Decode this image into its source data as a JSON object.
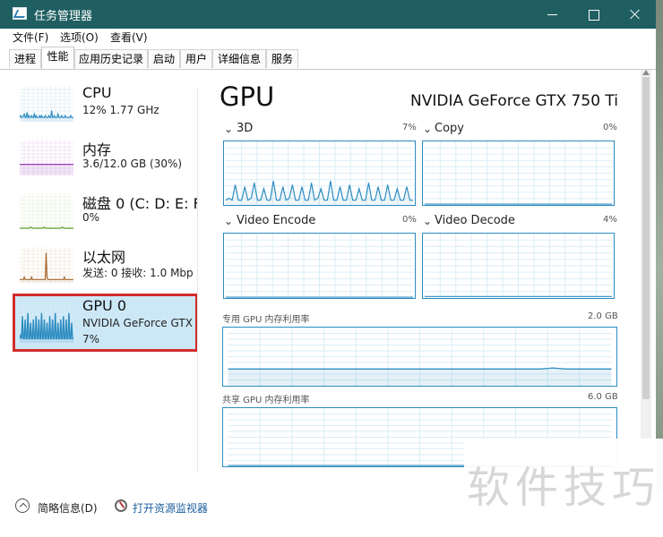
{
  "window": {
    "title": "任务管理器",
    "controls": {
      "minimize": "",
      "maximize": "",
      "close": ""
    }
  },
  "menu": [
    "文件(F)",
    "选项(O)",
    "查看(V)"
  ],
  "tabs": [
    "进程",
    "性能",
    "应用历史记录",
    "启动",
    "用户",
    "详细信息",
    "服务"
  ],
  "sidebar": {
    "items": [
      {
        "name": "CPU",
        "line1": "12% 1.77 GHz",
        "line2": "",
        "color": "#2c8bc0",
        "chart_data": {
          "type": "line",
          "values": [
            2,
            3,
            2,
            2,
            3,
            4,
            2,
            2,
            5,
            2,
            3,
            2,
            2,
            3,
            2,
            2,
            4,
            2,
            3,
            2,
            2,
            2,
            3,
            2,
            3,
            2,
            2,
            2,
            3,
            2,
            2,
            2,
            3,
            2,
            2,
            6,
            2,
            2,
            3,
            2,
            2,
            2,
            4,
            2,
            2,
            2,
            3,
            2,
            2,
            2,
            3,
            2,
            2,
            2,
            2,
            2,
            3,
            2,
            2,
            2
          ]
        }
      },
      {
        "name": "内存",
        "line1": "3.6/12.0 GB (30%)",
        "line2": "",
        "color": "#9b3db5",
        "chart_data": {
          "type": "area",
          "values": [
            30,
            30,
            30,
            30,
            30,
            30,
            30,
            30,
            30,
            30,
            30,
            30,
            30,
            30,
            30,
            30,
            30,
            30,
            30,
            30,
            30,
            30,
            30,
            30,
            30,
            30,
            30,
            30,
            30,
            30
          ]
        }
      },
      {
        "name": "磁盘 0 (C: D: E: F:",
        "line1": "0%",
        "line2": "",
        "color": "#5d9f2d",
        "chart_data": {
          "type": "line",
          "values": [
            0,
            0,
            0,
            0,
            0,
            0,
            1,
            0,
            0,
            0,
            0,
            0,
            0,
            1,
            0,
            0,
            0,
            0,
            0,
            0,
            0,
            0,
            0,
            1,
            0,
            0,
            0,
            0,
            0,
            0
          ]
        }
      },
      {
        "name": "以太网",
        "line1": "发送: 0 接收: 1.0 Mbp",
        "line2": "",
        "color": "#a5672e",
        "chart_data": {
          "type": "line",
          "values": [
            1,
            1,
            1,
            1,
            1,
            2,
            1,
            1,
            1,
            1,
            1,
            1,
            1,
            2,
            1,
            1,
            1,
            1,
            1,
            1,
            1,
            1,
            1,
            1,
            1,
            1,
            1,
            1,
            1,
            12,
            2,
            1,
            1,
            1,
            1,
            1,
            1,
            1,
            1,
            1,
            1,
            1,
            1,
            1,
            1,
            1,
            1,
            1,
            1,
            2,
            1,
            1,
            1,
            1,
            1,
            1,
            1,
            1,
            1,
            1
          ]
        }
      },
      {
        "name": "GPU 0",
        "line1": "NVIDIA GeForce GTX",
        "line2": "7%",
        "color": "#2c8bc0",
        "chart_data": {
          "type": "line",
          "values": [
            1,
            2,
            1,
            8,
            1,
            1,
            7,
            1,
            1,
            9,
            1,
            1,
            6,
            1,
            1,
            7,
            1,
            1,
            8,
            1,
            1,
            7,
            1,
            1,
            9,
            1,
            1,
            7,
            1,
            1,
            6,
            1,
            1,
            8,
            1,
            1,
            7,
            1,
            1,
            9,
            1,
            1,
            6,
            1,
            1,
            7,
            1,
            1,
            8,
            1,
            1,
            7,
            1,
            1,
            9,
            1,
            1,
            6,
            1,
            1
          ]
        }
      }
    ]
  },
  "main": {
    "title": "GPU",
    "gpu_name": "NVIDIA GeForce GTX 750 Ti",
    "engines": [
      {
        "label": "3D",
        "percent": "7%",
        "chart_data": {
          "type": "line",
          "values": [
            2,
            3,
            2,
            10,
            2,
            2,
            9,
            2,
            3,
            11,
            2,
            2,
            8,
            2,
            2,
            12,
            2,
            2,
            9,
            2,
            3,
            10,
            2,
            2,
            9,
            2,
            2,
            11,
            2,
            3,
            8,
            2,
            2,
            12,
            2,
            2,
            9,
            2,
            2,
            10,
            2,
            2,
            8,
            2,
            2,
            11,
            2,
            2,
            9,
            2,
            2,
            10,
            2,
            2,
            8,
            2,
            2,
            9,
            2,
            2
          ]
        }
      },
      {
        "label": "Copy",
        "percent": "0%",
        "chart_data": {
          "type": "line",
          "values": [
            0,
            0,
            0,
            0,
            0,
            0,
            0,
            0,
            0,
            0,
            0,
            0,
            0,
            0,
            0,
            0,
            0,
            0,
            0,
            0,
            0,
            0,
            0,
            0,
            0,
            0,
            0,
            0,
            0,
            0
          ]
        }
      },
      {
        "label": "Video Encode",
        "percent": "0%",
        "chart_data": {
          "type": "line",
          "values": [
            0,
            0,
            0,
            0,
            0,
            0,
            0,
            0,
            0,
            0,
            0,
            0,
            0,
            0,
            0,
            0,
            0,
            0,
            0,
            0,
            0,
            0,
            0,
            0,
            0,
            0,
            0,
            0,
            0,
            0
          ]
        }
      },
      {
        "label": "Video Decode",
        "percent": "4%",
        "chart_data": {
          "type": "line",
          "values": [
            1,
            1,
            1,
            1,
            1,
            1,
            1,
            1,
            1,
            1,
            1,
            1,
            1,
            1,
            1,
            1,
            1,
            1,
            1,
            1,
            1,
            1,
            1,
            1,
            1,
            1,
            1,
            1,
            1,
            1,
            1,
            1,
            1,
            1,
            1,
            1,
            1,
            1,
            1,
            1,
            1,
            1,
            1,
            1,
            1,
            1,
            1,
            1,
            1,
            1,
            1,
            1,
            1,
            1,
            1,
            1,
            1,
            1,
            1,
            1
          ]
        }
      }
    ],
    "memory_charts": [
      {
        "label": "专用 GPU 内存利用率",
        "value": "2.0 GB",
        "chart_data": {
          "type": "area",
          "values": [
            28,
            28,
            28,
            28,
            28,
            28,
            28,
            28,
            28,
            28,
            28,
            28,
            28,
            28,
            28,
            28,
            28,
            28,
            28,
            28,
            28,
            28,
            28,
            28,
            28,
            28,
            28,
            28,
            28,
            28,
            28,
            28,
            28,
            28,
            28,
            28,
            28,
            28,
            28,
            28,
            28,
            28,
            28,
            28,
            28,
            28,
            28,
            28,
            28,
            29,
            30,
            29,
            28,
            28,
            28,
            28,
            28,
            28,
            28,
            28
          ]
        }
      },
      {
        "label": "共享 GPU 内存利用率",
        "value": "6.0 GB",
        "chart_data": {
          "type": "area",
          "values": [
            0,
            0,
            0,
            0,
            0,
            0,
            0,
            0,
            0,
            0,
            0,
            0,
            0,
            0,
            0,
            0,
            0,
            0,
            0,
            0,
            0,
            0,
            0,
            0,
            0,
            0,
            0,
            0,
            0,
            0,
            0,
            0,
            0,
            0,
            0,
            0,
            0,
            0,
            0,
            0,
            0,
            0,
            0,
            0,
            0,
            0,
            0,
            0,
            0,
            0,
            0,
            0,
            0,
            0,
            0,
            0,
            0,
            0,
            0,
            0
          ]
        }
      }
    ]
  },
  "footer": {
    "summary": "简略信息(D)",
    "resource_monitor": "打开资源监视器"
  },
  "watermark": "软件技巧"
}
